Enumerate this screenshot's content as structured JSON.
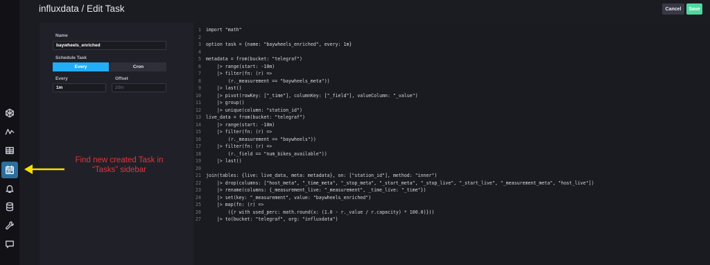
{
  "header": {
    "title": "influxdata / Edit Task",
    "cancel_label": "Cancel",
    "save_label": "Save"
  },
  "form": {
    "name_label": "Name",
    "name_value": "baywheels_enriched",
    "schedule_label": "Schedule Task",
    "schedule_options": [
      "Every",
      "Cron"
    ],
    "schedule_selected": "Every",
    "every_label": "Every",
    "every_value": "1m",
    "offset_label": "Offset",
    "offset_placeholder": "20m"
  },
  "editor": {
    "line_numbers": [
      "1",
      "2",
      "3",
      "4",
      "5",
      "6",
      "7",
      "8",
      "9",
      "10",
      "11",
      "12",
      "13",
      "14",
      "15",
      "16",
      "17",
      "18",
      "19",
      "20",
      "21",
      "22",
      "23",
      "24",
      "25",
      "26",
      "27"
    ],
    "lines": [
      "import \"math\"",
      "",
      "option task = {name: \"baywheels_enriched\", every: 1m}",
      "",
      "metadata = from(bucket: \"telegraf\")",
      "    |> range(start: -10m)",
      "    |> filter(fn: (r) =>",
      "        (r._measurement == \"baywheels_meta\"))",
      "    |> last()",
      "    |> pivot(rowKey: [\"_time\"], columnKey: [\"_field\"], valueColumn: \"_value\")",
      "    |> group()",
      "    |> unique(column: \"station_id\")",
      "live_data = from(bucket: \"telegraf\")",
      "    |> range(start: -10m)",
      "    |> filter(fn: (r) =>",
      "        (r._measurement == \"baywheels\"))",
      "    |> filter(fn: (r) =>",
      "        (r._field == \"num_bikes_available\"))",
      "    |> last()",
      "",
      "join(tables: {live: live_data, meta: metadata}, on: [\"station_id\"], method: \"inner\")",
      "    |> drop(columns: [\"host_meta\", \"_time_meta\", \"_stop_meta\", \"_start_meta\", \"_stop_live\", \"_start_live\", \"_measurement_meta\", \"host_live\"])",
      "    |> rename(columns: {_measurement_live: \"_measurement\", _time_live: \"_time\"})",
      "    |> set(key: \"_measurement\", value: \"baywheels_enriched\")",
      "    |> map(fn: (r) =>",
      "        ({r with used_perc: math.round(x: (1.0 - r._value / r.capacity) * 100.0)}))",
      "    |> to(bucket: \"telegraf\", org: \"influxdata\")"
    ]
  },
  "annotation": {
    "line1": "Find new created Task in",
    "line2": "“Tasks” sidebar",
    "color": "#e0363a",
    "arrow_color": "#f5e000"
  },
  "sidebar": {
    "items": [
      {
        "icon": "data-explorer-icon"
      },
      {
        "icon": "dashboards-icon"
      },
      {
        "icon": "table-icon"
      },
      {
        "icon": "tasks-icon",
        "active": true
      },
      {
        "icon": "alerts-icon"
      },
      {
        "icon": "database-icon"
      },
      {
        "icon": "settings-wrench-icon"
      },
      {
        "icon": "feedback-icon"
      }
    ]
  },
  "colors": {
    "accent": "#22adf6",
    "save": "#4ed8a0",
    "active_nav": "#2c6f9e"
  }
}
